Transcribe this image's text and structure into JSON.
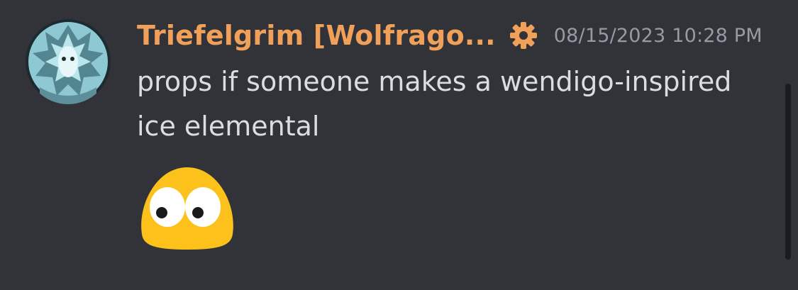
{
  "message": {
    "author": "Triefelgrim [Wolfrago...",
    "timestamp": "08/15/2023 10:28 PM",
    "content": "props if someone makes a wendigo-inspired ice elemental",
    "role_icon": "gear-icon",
    "avatar": "avatar-icon",
    "attachment_emoji": "googly-eyes-blob-emoji"
  },
  "colors": {
    "background": "#313338",
    "username": "#f0a059",
    "timestamp": "#949ba4",
    "text": "#dbdee1",
    "emoji_yellow": "#fcc21b"
  }
}
